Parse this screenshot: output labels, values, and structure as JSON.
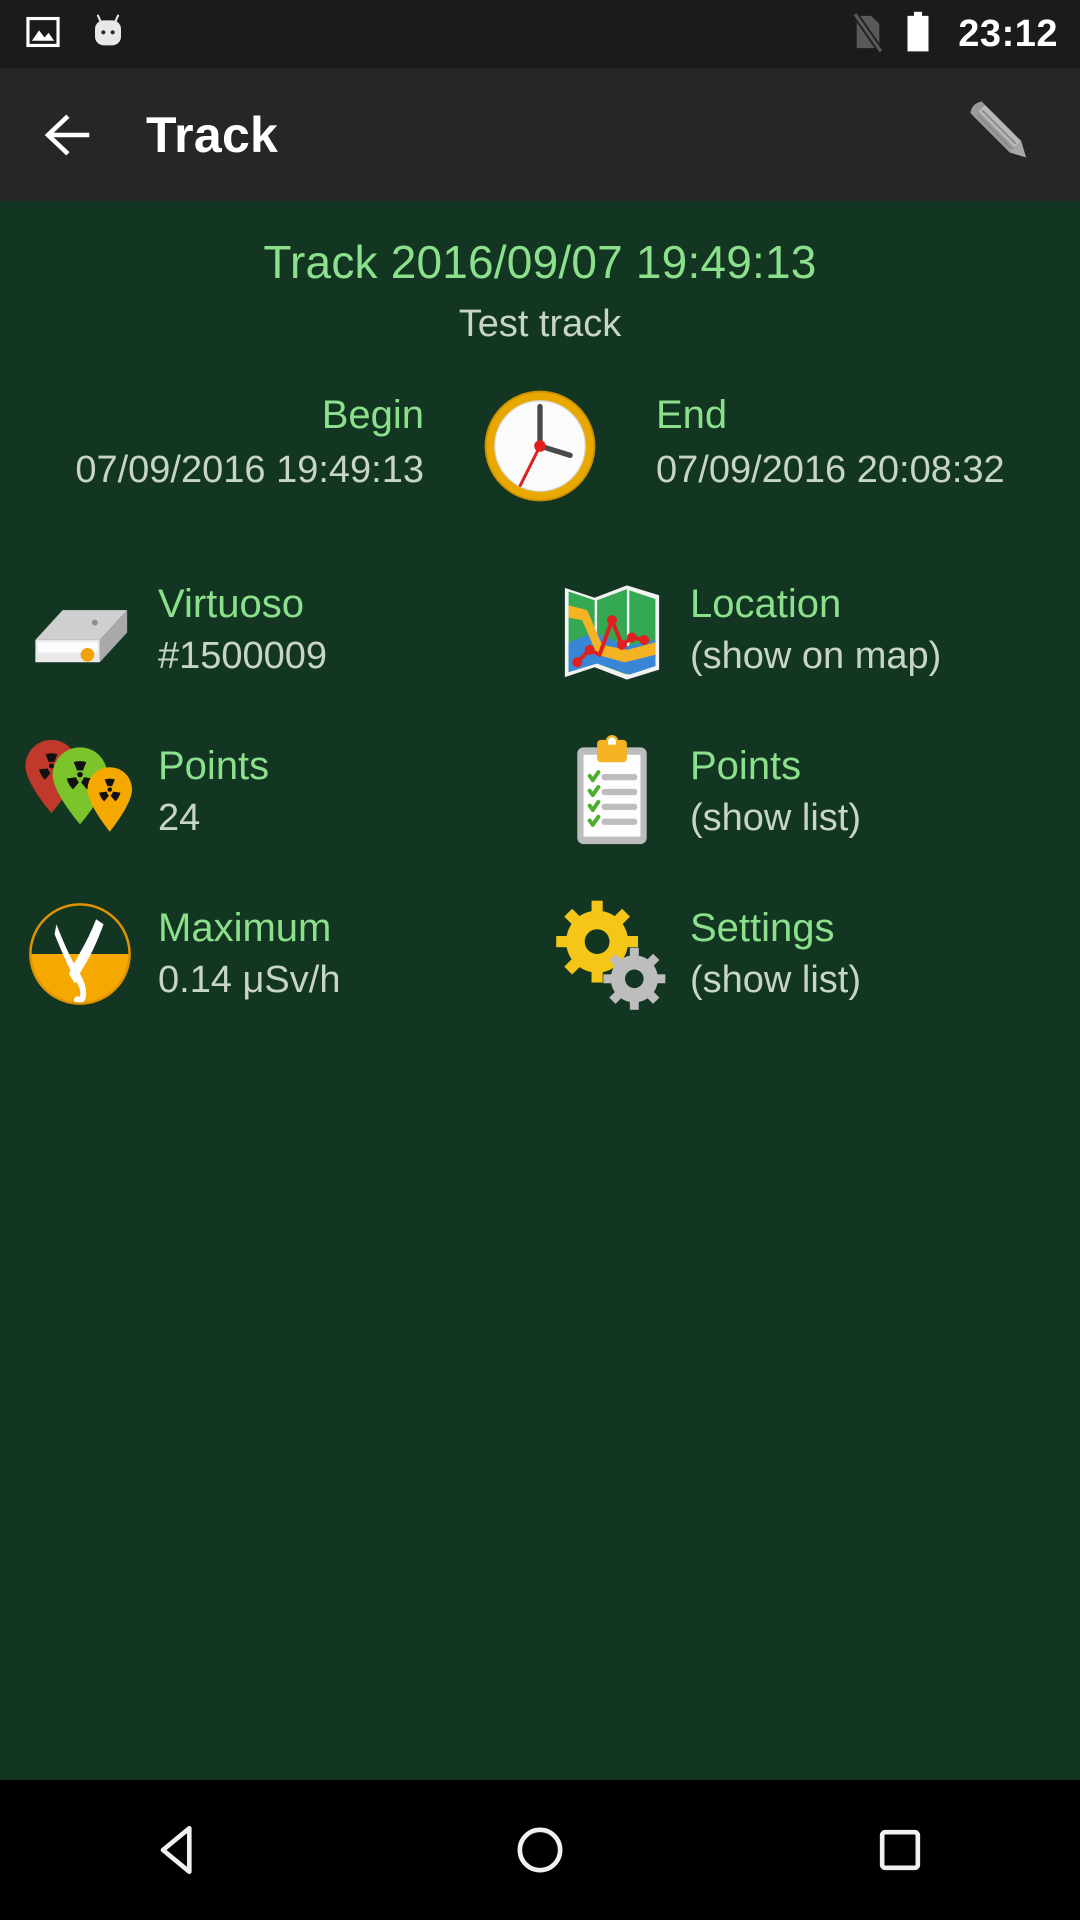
{
  "status_bar": {
    "icons": [
      "screenshot-image-icon",
      "android-marshmallow-icon",
      "no-sim-icon",
      "battery-full-icon"
    ],
    "time": "23:12"
  },
  "action_bar": {
    "back_icon": "arrow-left-icon",
    "title": "Track",
    "edit_icon": "pencil-icon"
  },
  "track": {
    "title": "Track 2016/09/07 19:49:13",
    "subtitle": "Test track"
  },
  "time_block": {
    "clock_icon": "analog-clock-icon",
    "begin_label": "Begin",
    "begin_value": "07/09/2016 19:49:13",
    "end_label": "End",
    "end_value": "07/09/2016 20:08:32"
  },
  "info_cells": [
    {
      "icon": "device-box-icon",
      "title": "Virtuoso",
      "sub": "#1500009"
    },
    {
      "icon": "folded-map-icon",
      "title": "Location",
      "sub": "(show on map)"
    },
    {
      "icon": "radiation-pins-icon",
      "title": "Points",
      "sub": "24"
    },
    {
      "icon": "clipboard-checklist-icon",
      "title": "Points",
      "sub": "(show list)"
    },
    {
      "icon": "gamma-radiation-icon",
      "title": "Maximum",
      "sub": "0.14 μSv/h"
    },
    {
      "icon": "gears-icon",
      "title": "Settings",
      "sub": "(show list)"
    }
  ],
  "nav_bar": {
    "back_icon": "nav-back-triangle-icon",
    "home_icon": "nav-home-circle-icon",
    "recents_icon": "nav-recents-square-icon"
  },
  "colors": {
    "background": "#123622",
    "accent_green": "#8ce08c",
    "value_text": "#c8d4c8",
    "action_bar": "#262626",
    "status_bar": "#1b1b1b",
    "nav_bar": "#000000",
    "amber": "#f5a800"
  }
}
